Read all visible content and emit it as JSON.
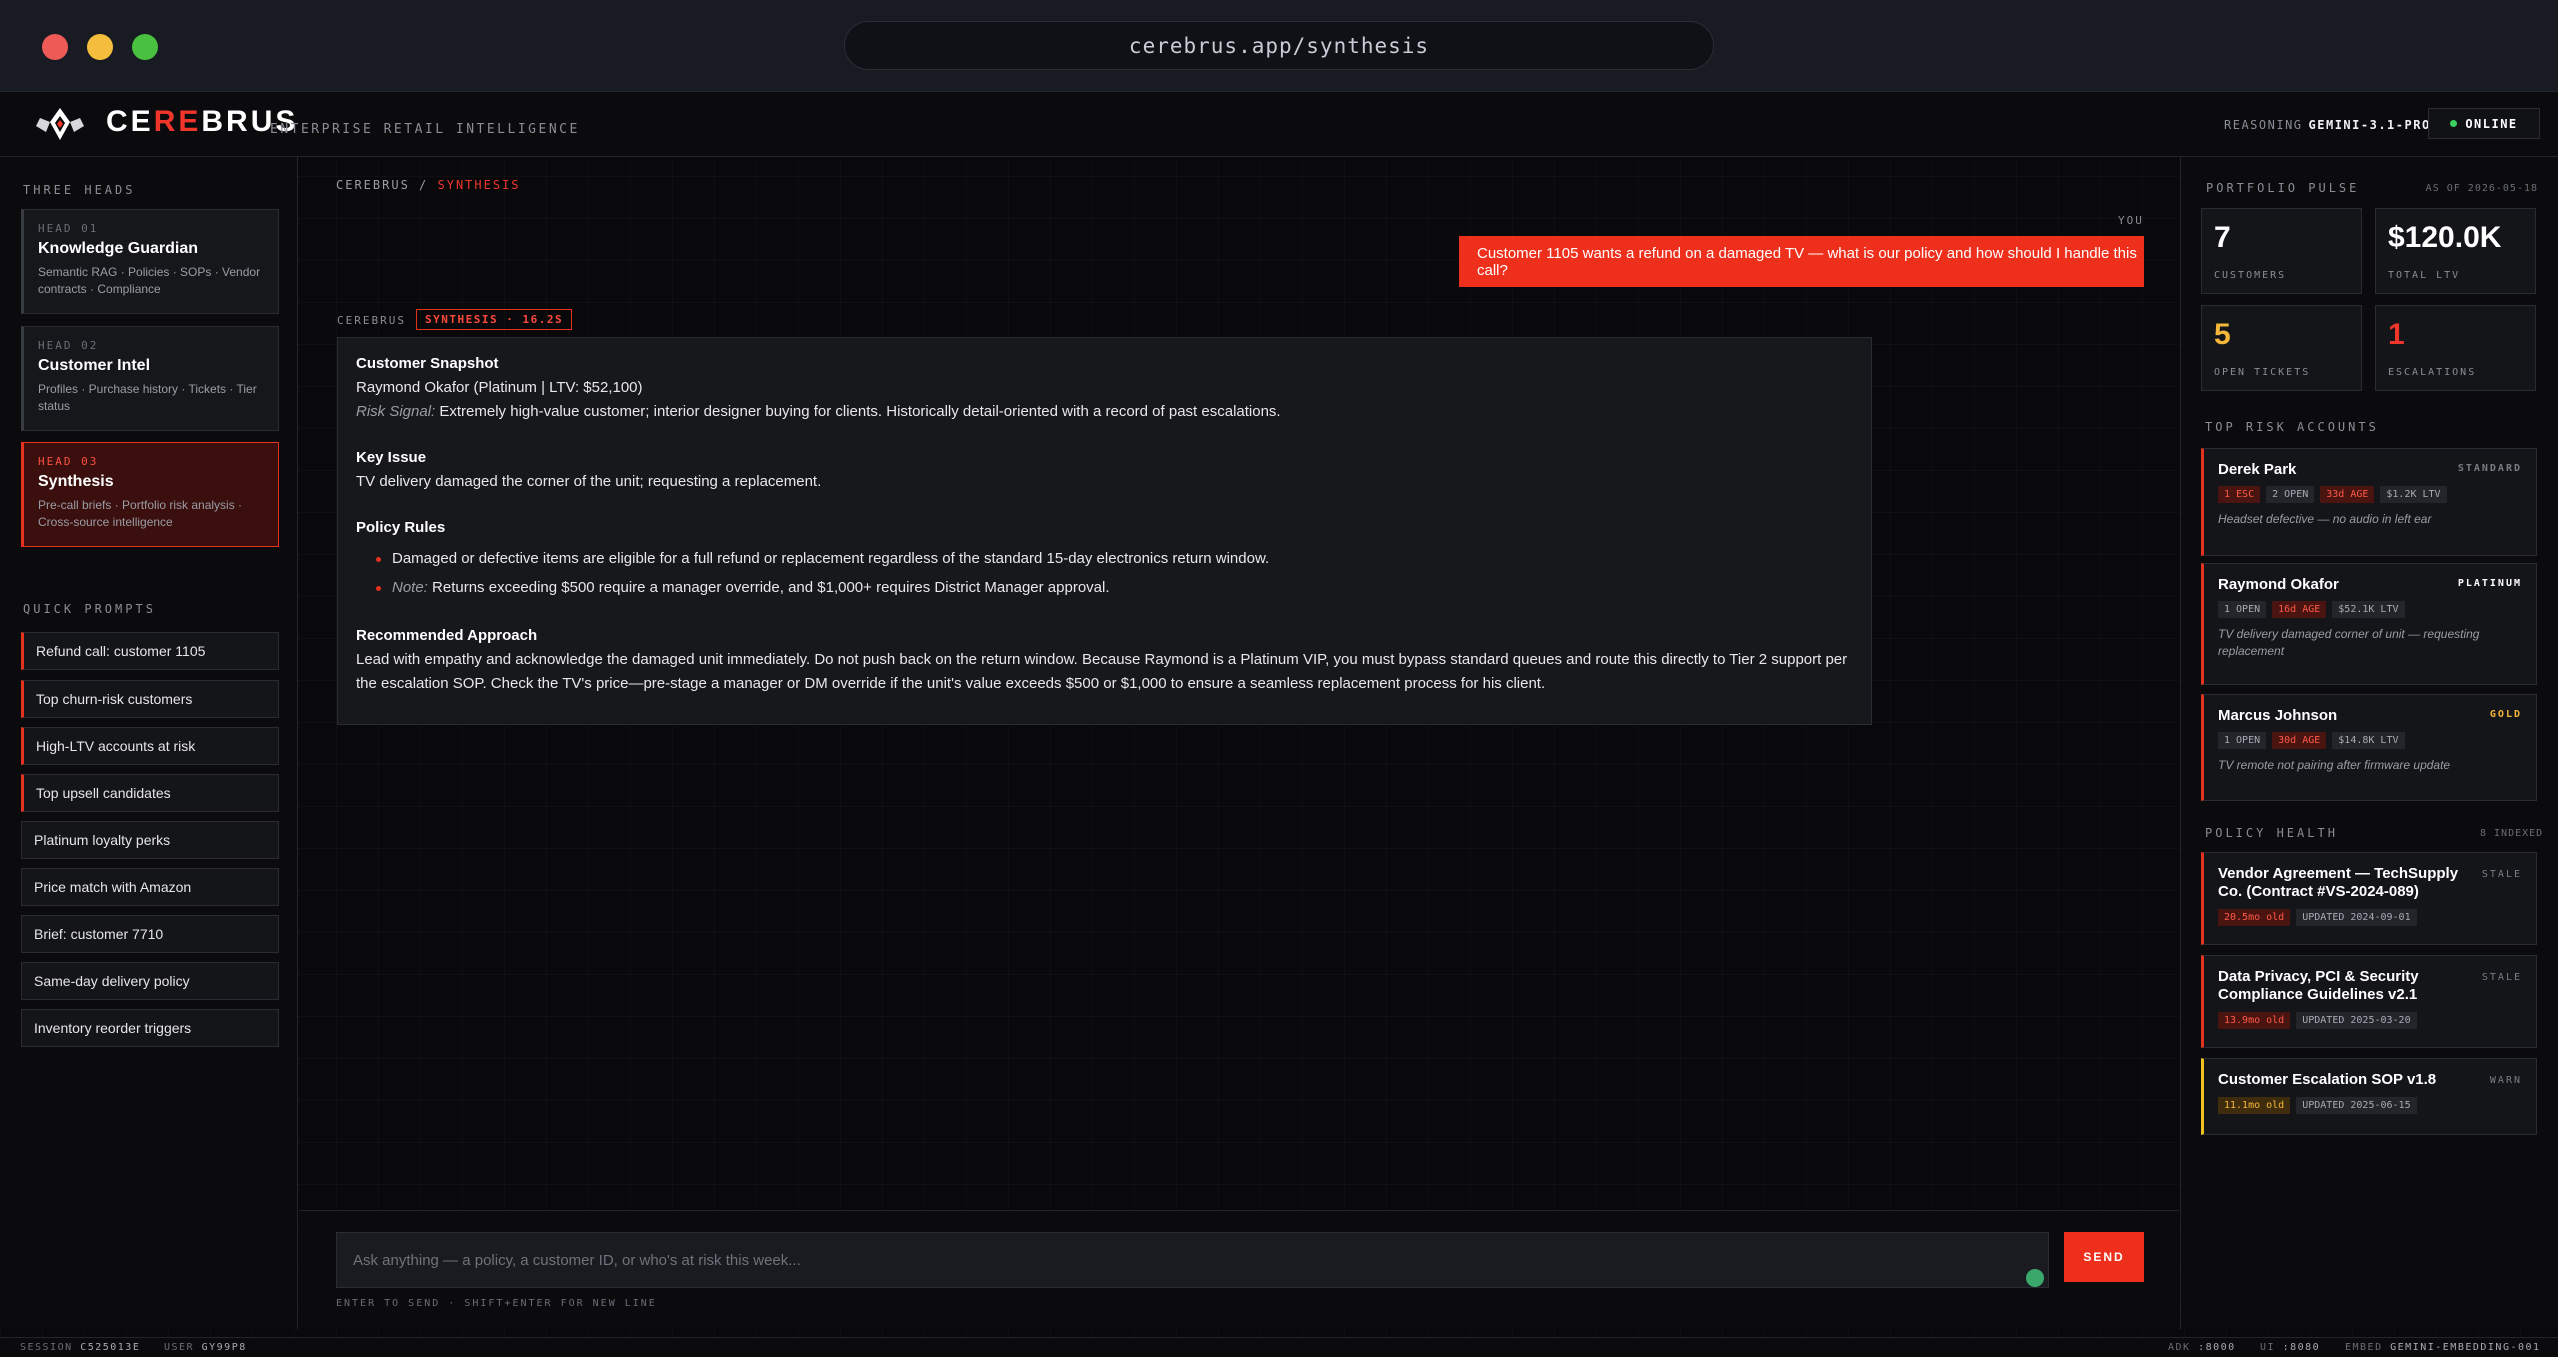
{
  "browser": {
    "url": "cerebrus.app/synthesis"
  },
  "header": {
    "logo_pre": "CE",
    "logo_red": "RE",
    "logo_post": "BRUS",
    "tagline": "ENTERPRISE RETAIL INTELLIGENCE",
    "reasoning_label": "REASONING",
    "reasoning_model": "GEMINI-3.1-PRO",
    "status": "ONLINE"
  },
  "sidebar": {
    "heads_title": "THREE HEADS",
    "heads": [
      {
        "num": "HEAD 01",
        "title": "Knowledge Guardian",
        "desc": "Semantic RAG · Policies · SOPs · Vendor contracts · Compliance"
      },
      {
        "num": "HEAD 02",
        "title": "Customer Intel",
        "desc": "Profiles · Purchase history · Tickets · Tier status"
      },
      {
        "num": "HEAD 03",
        "title": "Synthesis",
        "desc": "Pre-call briefs · Portfolio risk analysis · Cross-source intelligence"
      }
    ],
    "prompts_title": "QUICK PROMPTS",
    "prompts": [
      "Refund call: customer 1105",
      "Top churn-risk customers",
      "High-LTV accounts at risk",
      "Top upsell candidates",
      "Platinum loyalty perks",
      "Price match with Amazon",
      "Brief: customer 7710",
      "Same-day delivery policy",
      "Inventory reorder triggers"
    ]
  },
  "chat": {
    "breadcrumb_root": "CEREBRUS",
    "breadcrumb_sep": "/",
    "breadcrumb_current": "SYNTHESIS",
    "you_label": "YOU",
    "user_message": "Customer 1105 wants a refund on a damaged TV — what is our policy and how should I handle this call?",
    "bot_label": "CEREBRUS",
    "bot_tag": "SYNTHESIS · 16.2S",
    "answer": {
      "snapshot_title": "Customer Snapshot",
      "snapshot_line": "Raymond Okafor (Platinum | LTV: $52,100)",
      "risk_label": "Risk Signal:",
      "risk_text": "Extremely high-value customer; interior designer buying for clients. Historically detail-oriented with a record of past escalations.",
      "issue_title": "Key Issue",
      "issue_text": "TV delivery damaged the corner of the unit; requesting a replacement.",
      "rules_title": "Policy Rules",
      "rule_1": "Damaged or defective items are eligible for a full refund or replacement regardless of the standard 15-day electronics return window.",
      "rule_2_label": "Note:",
      "rule_2_text": "Returns exceeding $500 require a manager override, and $1,000+ requires District Manager approval.",
      "approach_title": "Recommended Approach",
      "approach_text": "Lead with empathy and acknowledge the damaged unit immediately. Do not push back on the return window. Because Raymond is a Platinum VIP, you must bypass standard queues and route this directly to Tier 2 support per the escalation SOP. Check the TV's price—pre-stage a manager or DM override if the unit's value exceeds $500 or $1,000 to ensure a seamless replacement process for his client."
    },
    "input_placeholder": "Ask anything — a policy, a customer ID, or who's at risk this week...",
    "send_label": "SEND",
    "hint": "ENTER TO SEND · SHIFT+ENTER FOR NEW LINE"
  },
  "pulse": {
    "title": "PORTFOLIO PULSE",
    "as_of": "AS OF 2026-05-18",
    "stats": [
      {
        "value": "7",
        "label": "CUSTOMERS",
        "color": "#ffffff"
      },
      {
        "value": "$120.0K",
        "label": "TOTAL LTV",
        "color": "#ffffff"
      },
      {
        "value": "5",
        "label": "OPEN TICKETS",
        "color": "#f5b73a"
      },
      {
        "value": "1",
        "label": "ESCALATIONS",
        "color": "#f0362a"
      }
    ]
  },
  "risk": {
    "title": "TOP RISK ACCOUNTS",
    "accounts": [
      {
        "name": "Derek Park",
        "tier": "STANDARD",
        "tier_color": "#7a7d86",
        "chips": [
          "1 ESC",
          "2 OPEN",
          "33d AGE",
          "$1.2K LTV"
        ],
        "note": "Headset defective — no audio in left ear"
      },
      {
        "name": "Raymond Okafor",
        "tier": "PLATINUM",
        "tier_color": "#ffffff",
        "chips": [
          "1 OPEN",
          "16d AGE",
          "$52.1K LTV"
        ],
        "note": "TV delivery damaged corner of unit — requesting replacement"
      },
      {
        "name": "Marcus Johnson",
        "tier": "GOLD",
        "tier_color": "#f5b73a",
        "chips": [
          "1 OPEN",
          "30d AGE",
          "$14.8K LTV"
        ],
        "note": "TV remote not pairing after firmware update"
      }
    ]
  },
  "policy": {
    "title": "POLICY HEALTH",
    "indexed": "8 INDEXED",
    "items": [
      {
        "name": "Vendor Agreement — TechSupply Co. (Contract #VS-2024-089)",
        "status": "STALE",
        "age": "20.5mo old",
        "updated": "UPDATED 2024-09-01"
      },
      {
        "name": "Data Privacy, PCI & Security Compliance Guidelines v2.1",
        "status": "STALE",
        "age": "13.9mo old",
        "updated": "UPDATED 2025-03-20"
      },
      {
        "name": "Customer Escalation SOP v1.8",
        "status": "WARN",
        "age": "11.1mo old",
        "updated": "UPDATED 2025-06-15"
      }
    ]
  },
  "footer": {
    "session_label": "SESSION",
    "session": "C525013E",
    "user_label": "USER",
    "user": "GY99P8",
    "adk_label": "ADK",
    "adk": ":8000",
    "ui_label": "UI",
    "ui": ":8080",
    "embed_label": "EMBED",
    "embed": "GEMINI-EMBEDDING-001"
  }
}
